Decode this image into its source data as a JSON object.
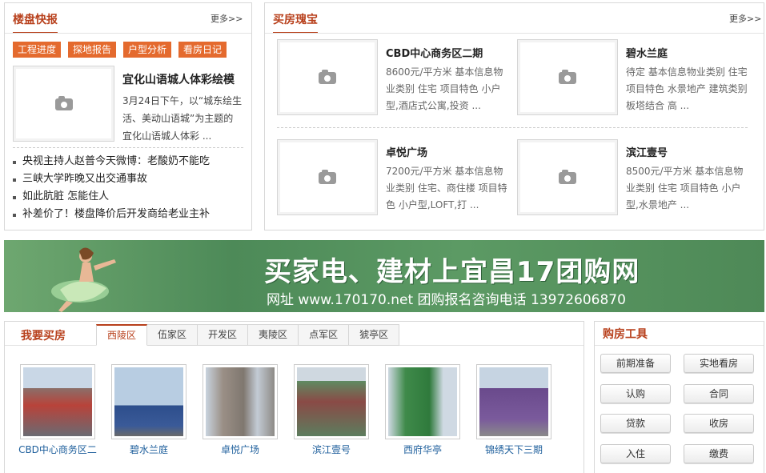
{
  "news_panel": {
    "title": "楼盘快报",
    "more": "更多>>",
    "tags": [
      "工程进度",
      "探地报告",
      "户型分析",
      "看房日记"
    ],
    "headline": "宜化山语城人体彩绘模",
    "summary": "3月24日下午，以“城东绘生活、美动山语城”为主题的宜化山语城人体彩 ...",
    "list": [
      "央视主持人赵普今天微博：老酸奶不能吃",
      "三峡大学昨晚又出交通事故",
      "如此肮脏 怎能住人",
      "补差价了！楼盘降价后开发商给老业主补"
    ]
  },
  "picks_panel": {
    "title": "买房瑰宝",
    "more": "更多>>",
    "items": [
      {
        "name": "CBD中心商务区二期",
        "desc": "8600元/平方米 基本信息物业类别 住宅 项目特色 小户型,酒店式公寓,投资 ..."
      },
      {
        "name": "碧水兰庭",
        "desc": "待定 基本信息物业类别 住宅 项目特色 水景地产 建筑类别 板塔结合 高 ..."
      },
      {
        "name": "卓悦广场",
        "desc": "7200元/平方米 基本信息物业类别 住宅、商住楼 项目特色 小户型,LOFT,打 ..."
      },
      {
        "name": "滨江壹号",
        "desc": "8500元/平方米 基本信息物业类别 住宅 项目特色 小户型,水景地产 ..."
      }
    ]
  },
  "banner": {
    "headline": "买家电、建材上宜昌17团购网",
    "subline": "网址 www.170170.net   团购报名咨询电话 13972606870"
  },
  "buy_panel": {
    "title": "我要买房",
    "tabs": [
      "西陵区",
      "伍家区",
      "开发区",
      "夷陵区",
      "点军区",
      "猇亭区"
    ],
    "active_tab": "西陵区",
    "properties": [
      "CBD中心商务区二",
      "碧水兰庭",
      "卓悦广场",
      "滨江壹号",
      "西府华亭",
      "锦绣天下三期"
    ]
  },
  "tools_panel": {
    "title": "购房工具",
    "buttons": [
      "前期准备",
      "实地看房",
      "认购",
      "合同",
      "贷款",
      "收房",
      "入住",
      "缴费"
    ]
  },
  "colors": {
    "accent": "#b8401c",
    "tag_bg": "#e46a2e",
    "banner_green": "#5c9a64",
    "link": "#1e5f9c"
  }
}
